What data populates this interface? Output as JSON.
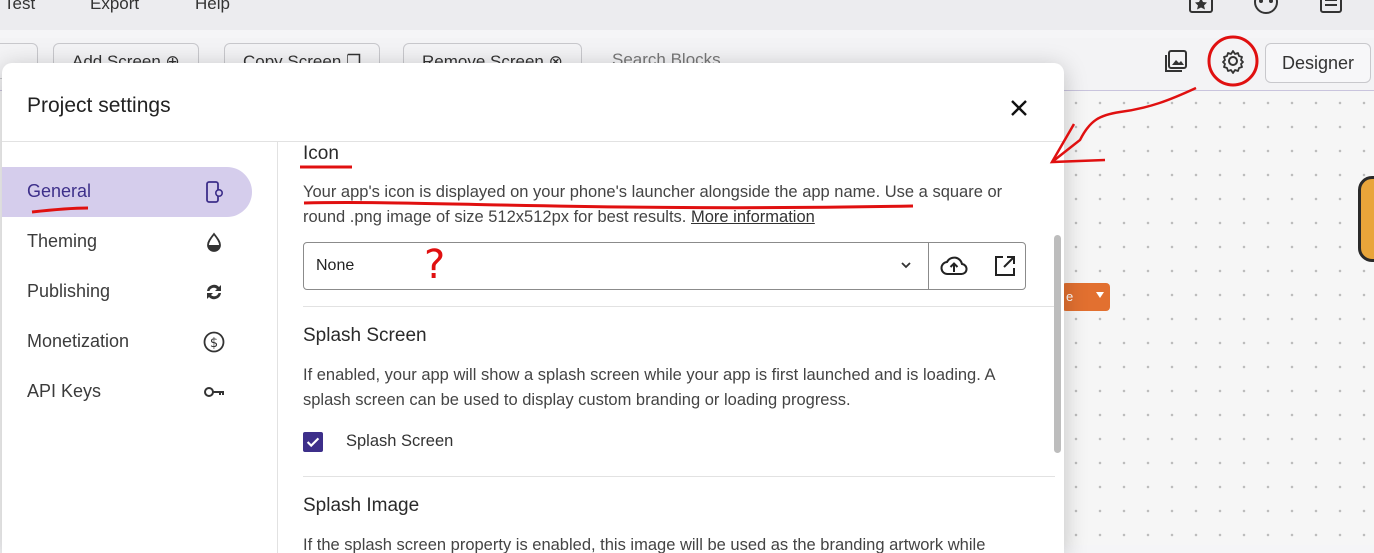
{
  "menubar": {
    "items": [
      "Test",
      "Export",
      "Help"
    ]
  },
  "toolbar": {
    "add_screen": "Add Screen ⊕",
    "copy_screen": "Copy Screen ❐",
    "remove_screen": "Remove Screen ⊗",
    "search_blocks": "Search Blocks",
    "designer": "Designer"
  },
  "workspace": {
    "block_chip_text": "e"
  },
  "dialog": {
    "title": "Project settings",
    "sidebar": [
      {
        "label": "General",
        "icon": "settings-phone-icon",
        "active": true
      },
      {
        "label": "Theming",
        "icon": "drop-icon",
        "active": false
      },
      {
        "label": "Publishing",
        "icon": "sync-icon",
        "active": false
      },
      {
        "label": "Monetization",
        "icon": "dollar-circle-icon",
        "active": false
      },
      {
        "label": "API Keys",
        "icon": "key-icon",
        "active": false
      }
    ],
    "icon_section": {
      "heading": "Icon",
      "desc": "Your app's icon is displayed on your phone's launcher alongside the app name. Use a square or round .png image of size 512x512px for best results.",
      "link": "More information",
      "select_value": "None"
    },
    "splash_section": {
      "heading": "Splash Screen",
      "desc": "If enabled, your app will show a splash screen while your app is first launched and is loading. A splash screen can be used to display custom branding or loading progress.",
      "checkbox_label": "Splash Screen",
      "checked": true
    },
    "splash_image_section": {
      "heading": "Splash Image",
      "desc": "If the splash screen property is enabled, this image will be used as the branding artwork while"
    }
  },
  "annotations": {
    "question_mark": "?"
  },
  "colors": {
    "accent": "#3d2f8a",
    "active_bg": "#d5cdec",
    "annotation_red": "#e01010"
  }
}
